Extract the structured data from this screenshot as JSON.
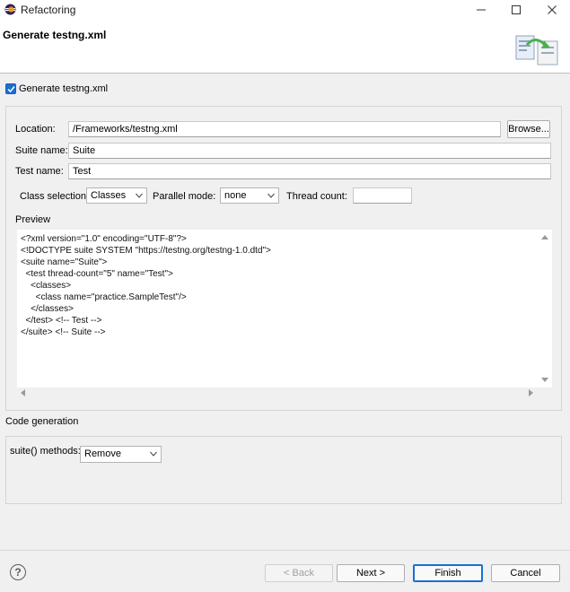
{
  "window": {
    "title": "Refactoring"
  },
  "header": {
    "title": "Generate testng.xml"
  },
  "generate_checkbox": {
    "label": "Generate testng.xml",
    "checked": true
  },
  "form": {
    "location_label": "Location:",
    "location_value": "/Frameworks/testng.xml",
    "browse_label": "Browse...",
    "suite_name_label": "Suite name:",
    "suite_name_value": "Suite",
    "test_name_label": "Test name:",
    "test_name_value": "Test",
    "class_selection_label": "Class selection:",
    "class_selection_value": "Classes",
    "parallel_mode_label": "Parallel mode:",
    "parallel_mode_value": "none",
    "thread_count_label": "Thread count:",
    "thread_count_value": ""
  },
  "preview": {
    "label": "Preview",
    "content": "<?xml version=\"1.0\" encoding=\"UTF-8\"?>\n<!DOCTYPE suite SYSTEM \"https://testng.org/testng-1.0.dtd\">\n<suite name=\"Suite\">\n  <test thread-count=\"5\" name=\"Test\">\n    <classes>\n      <class name=\"practice.SampleTest\"/>\n    </classes>\n  </test> <!-- Test -->\n</suite> <!-- Suite -->"
  },
  "code_generation": {
    "label": "Code generation",
    "suite_methods_label": "suite() methods:",
    "suite_methods_value": "Remove"
  },
  "buttons": {
    "back": "< Back",
    "next": "Next >",
    "finish": "Finish",
    "cancel": "Cancel",
    "help": "?"
  },
  "colors": {
    "accent": "#1a6fd1",
    "background": "#f0f0f0"
  }
}
